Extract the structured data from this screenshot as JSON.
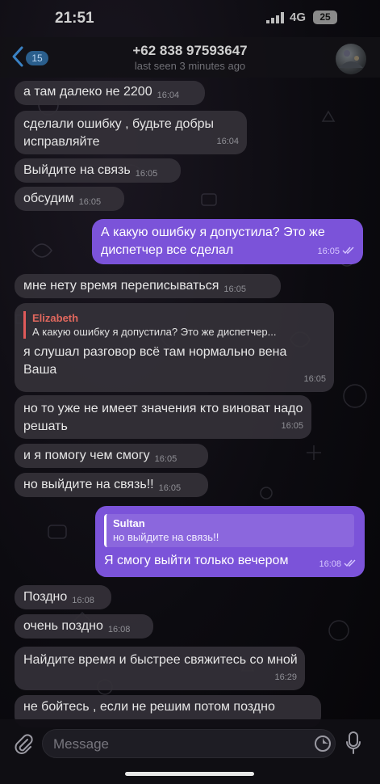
{
  "status": {
    "time": "21:51",
    "network": "4G",
    "battery": "25"
  },
  "header": {
    "back_count": "15",
    "title": "+62 838 97593647",
    "subtitle": "last seen 3 minutes ago"
  },
  "messages": [
    {
      "dir": "in",
      "text": "а там далеко не 2200",
      "time": "16:04"
    },
    {
      "dir": "in",
      "text": "сделали ошибку , будьте добры исправляйте",
      "time": "16:04"
    },
    {
      "dir": "in",
      "text": "Выйдите на связь",
      "time": "16:05"
    },
    {
      "dir": "in",
      "text": "обсудим",
      "time": "16:05"
    },
    {
      "dir": "out",
      "text": "А какую ошибку я допустила? Это же диспетчер все сделал",
      "time": "16:05"
    },
    {
      "dir": "in",
      "text": "мне нету время переписываться",
      "time": "16:05"
    },
    {
      "dir": "in",
      "reply_name": "Elizabeth",
      "reply_text": "А какую ошибку я допустила? Это же диспетчер...",
      "text": "я слушал разговор всё там нормально вена Ваша",
      "time": "16:05"
    },
    {
      "dir": "in",
      "text": "но то уже не имеет значения кто виноват надо решать",
      "time": "16:05"
    },
    {
      "dir": "in",
      "text": "и я помогу чем смогу",
      "time": "16:05"
    },
    {
      "dir": "in",
      "text": "но выйдите на связь!!",
      "time": "16:05"
    },
    {
      "dir": "out",
      "reply_name": "Sultan",
      "reply_text": "но выйдите на связь!!",
      "text": "Я смогу выйти только вечером",
      "time": "16:08"
    },
    {
      "dir": "in",
      "text": "Поздно",
      "time": "16:08"
    },
    {
      "dir": "in",
      "text": "очень поздно",
      "time": "16:08"
    },
    {
      "dir": "in",
      "text": "Найдите время и быстрее свяжитесь со мной",
      "time": "16:29"
    },
    {
      "dir": "in",
      "text": "не бойтесь , если не решим потом поздно",
      "time": ""
    }
  ],
  "input": {
    "placeholder": "Message"
  },
  "colors": {
    "outgoing": "#7b53d9",
    "incoming": "#343138",
    "reply_accent": "#e2685e",
    "badge": "#2a5e8c"
  }
}
